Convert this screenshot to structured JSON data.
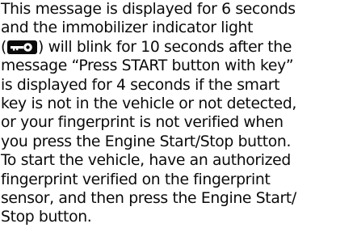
{
  "paragraph": {
    "line1": "This message is displayed for 6 seconds",
    "line2": "and the immobilizer indicator light",
    "line3_open": "(",
    "line3_rest": ") will blink for 10 seconds after the",
    "line4": "message “Press START button with key”",
    "line5": "is displayed for 4 seconds if the smart",
    "line6": "key is not in the vehicle or not detected,",
    "line7": "or your fingerprint is not verified when",
    "line8": "you press the Engine Start/Stop button.",
    "line9": "To start the vehicle, have an authorized",
    "line10": "fingerprint verified on the fingerprint",
    "line11": "sensor, and then press the Engine Start/",
    "line12": "Stop button."
  },
  "icons": {
    "immobilizer": "key-icon"
  },
  "colors": {
    "text": "#0a0a0a",
    "background": "#ffffff"
  }
}
